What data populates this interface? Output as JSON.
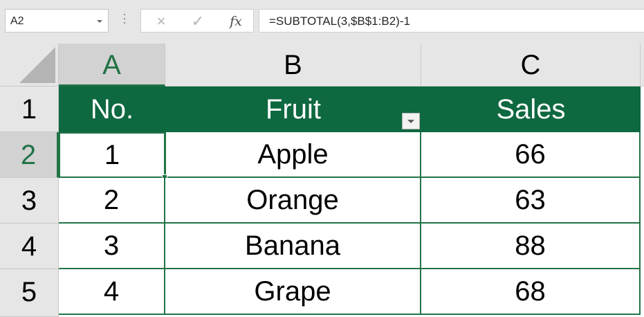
{
  "formula_bar": {
    "name_box": "A2",
    "cancel_icon": "×",
    "enter_icon": "✓",
    "fx_label": "fx",
    "formula": "=SUBTOTAL(3,$B$1:B2)-1"
  },
  "columns": [
    "A",
    "B",
    "C"
  ],
  "rows": [
    "1",
    "2",
    "3",
    "4",
    "5"
  ],
  "table": {
    "headers": [
      "No.",
      "Fruit",
      "Sales"
    ],
    "data": [
      [
        "1",
        "Apple",
        "66"
      ],
      [
        "2",
        "Orange",
        "63"
      ],
      [
        "3",
        "Banana",
        "88"
      ],
      [
        "4",
        "Grape",
        "68"
      ]
    ]
  },
  "selection": {
    "active_cell": "A2"
  },
  "colors": {
    "table_header_bg": "#0e6840",
    "accent_green": "#217346",
    "header_bg": "#e6e6e6"
  }
}
